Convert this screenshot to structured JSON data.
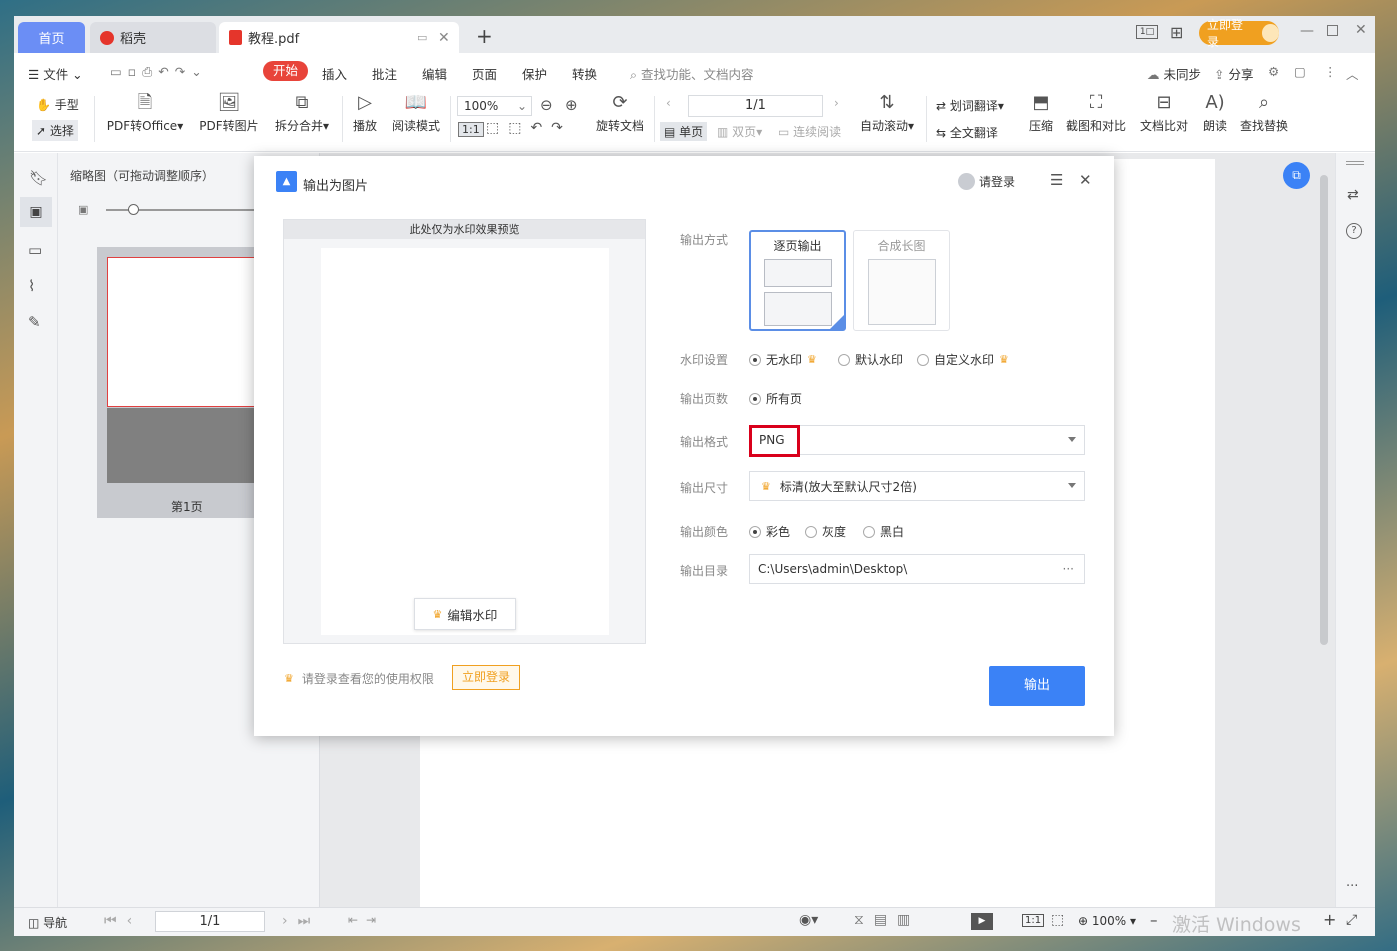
{
  "tabs": {
    "home": "首页",
    "daoke": "稻壳",
    "doc": "教程.pdf",
    "new": "+"
  },
  "titlebar": {
    "login": "立即登录"
  },
  "menu": {
    "file": "文件",
    "items": [
      "开始",
      "插入",
      "批注",
      "编辑",
      "页面",
      "保护",
      "转换"
    ],
    "search": "查找功能、文档内容",
    "sync": "未同步",
    "share": "分享"
  },
  "toolbar": {
    "hand": "手型",
    "select": "选择",
    "pdf_office": "PDF转Office",
    "pdf_image": "PDF转图片",
    "split_merge": "拆分合并",
    "play": "播放",
    "read_mode": "阅读模式",
    "zoom": "100%",
    "rotate": "旋转文档",
    "page_input": "1/1",
    "single": "单页",
    "double": "双页",
    "continuous": "连续阅读",
    "auto_scroll": "自动滚动",
    "word_translate": "划词翻译",
    "full_translate": "全文翻译",
    "compress": "压缩",
    "screenshot": "截图和对比",
    "compare": "文档比对",
    "read_aloud": "朗读",
    "find_replace": "查找替换"
  },
  "thumbs": {
    "title": "缩略图（可拖动调整顺序）",
    "page1": "第1页"
  },
  "status": {
    "nav": "导航",
    "page": "1/1",
    "zoom": "100%",
    "watermark": "激活 Windows"
  },
  "dialog": {
    "title": "输出为图片",
    "login": "请登录",
    "preview_header": "此处仅为水印效果预览",
    "edit_watermark": "编辑水印",
    "labels": {
      "mode": "输出方式",
      "watermark": "水印设置",
      "pages": "输出页数",
      "format": "输出格式",
      "size": "输出尺寸",
      "color": "输出颜色",
      "dir": "输出目录"
    },
    "mode_options": {
      "per_page": "逐页输出",
      "long": "合成长图"
    },
    "watermark_options": {
      "none": "无水印",
      "default": "默认水印",
      "custom": "自定义水印"
    },
    "pages_option": "所有页",
    "format_value": "PNG",
    "size_value": "标清(放大至默认尺寸2倍)",
    "color_options": {
      "color": "彩色",
      "gray": "灰度",
      "bw": "黑白"
    },
    "dir_value": "C:\\Users\\admin\\Desktop\\",
    "dir_more": "···",
    "footer_hint": "请登录查看您的使用权限",
    "footer_login": "立即登录",
    "export": "输出"
  },
  "colors": {
    "accent": "#3b82f6",
    "red": "#d9001b",
    "crown": "#f0a020",
    "start_btn": "#e8443a"
  }
}
